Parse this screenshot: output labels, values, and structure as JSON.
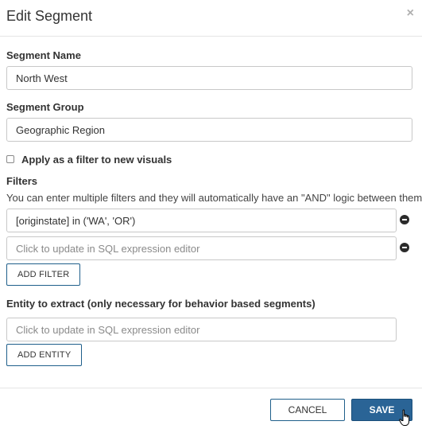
{
  "dialog": {
    "title": "Edit Segment",
    "close_icon": "close-icon",
    "close_glyph": "×"
  },
  "segment_name": {
    "label": "Segment Name",
    "value": "North West"
  },
  "segment_group": {
    "label": "Segment Group",
    "value": "Geographic Region"
  },
  "apply_filter": {
    "label": "Apply as a filter to new visuals",
    "checked": false
  },
  "filters": {
    "label": "Filters",
    "help": "You can enter multiple filters and they will automatically have an \"AND\" logic between them",
    "items": [
      {
        "value": "[originstate] in ('WA', 'OR')",
        "placeholder": ""
      },
      {
        "value": "",
        "placeholder": "Click to update in SQL expression editor"
      }
    ],
    "remove_icon": "remove-circle-icon",
    "add_label": "ADD FILTER"
  },
  "entity": {
    "label": "Entity to extract (only necessary for behavior based segments)",
    "placeholder": "Click to update in SQL expression editor",
    "add_label": "ADD ENTITY"
  },
  "footer": {
    "cancel_label": "CANCEL",
    "save_label": "SAVE"
  },
  "colors": {
    "primary": "#2a6496",
    "outline": "#1f5f8b"
  },
  "cursor_icon": "hand-pointer-icon"
}
